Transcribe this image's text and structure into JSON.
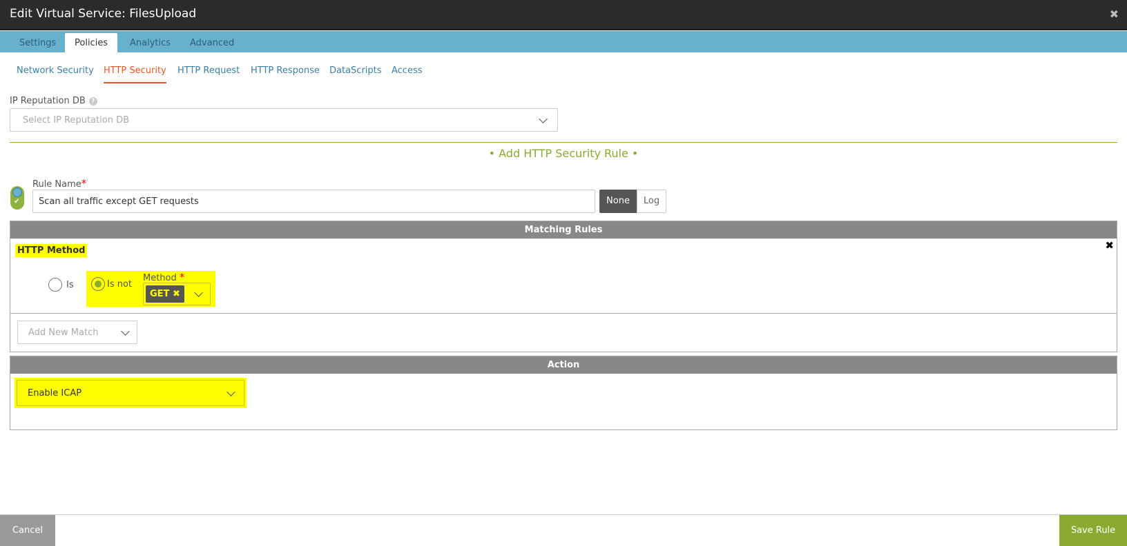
{
  "window": {
    "title": "Edit Virtual Service: FilesUpload",
    "close_icon": "close-icon"
  },
  "tabs": [
    {
      "label": "Settings",
      "active": false
    },
    {
      "label": "Policies",
      "active": true
    },
    {
      "label": "Analytics",
      "active": false
    },
    {
      "label": "Advanced",
      "active": false
    }
  ],
  "subtabs": [
    {
      "label": "Network Security",
      "active": false
    },
    {
      "label": "HTTP Security",
      "active": true
    },
    {
      "label": "HTTP Request",
      "active": false
    },
    {
      "label": "HTTP Response",
      "active": false
    },
    {
      "label": "DataScripts",
      "active": false
    },
    {
      "label": "Access",
      "active": false
    }
  ],
  "ip_reputation": {
    "label": "IP Reputation DB",
    "help_icon": "question-icon",
    "placeholder": "Select IP Reputation DB"
  },
  "rule": {
    "header": "• Add HTTP Security Rule •",
    "name_label": "Rule Name",
    "required_mark": "*",
    "name_value": "Scan all traffic except GET requests",
    "enabled": true,
    "log_options": [
      "None",
      "Log"
    ],
    "log_selected": "None"
  },
  "matching": {
    "header": "Matching Rules",
    "method_title": "HTTP Method",
    "is_label": "Is",
    "is_not_label": "Is not",
    "selected": "Is not",
    "method_label": "Method",
    "method_tag": "GET ✖",
    "add_match_placeholder": "Add New Match"
  },
  "action": {
    "header": "Action",
    "value": "Enable ICAP"
  },
  "footer": {
    "cancel_label": "Cancel",
    "save_label": "Save Rule"
  },
  "colors": {
    "titlebar": "#2b2b2b",
    "tabbar": "#67b1cf",
    "accent_green": "#8aab2f",
    "active_subtab": "#e9542a",
    "highlight": "#ffff00"
  }
}
